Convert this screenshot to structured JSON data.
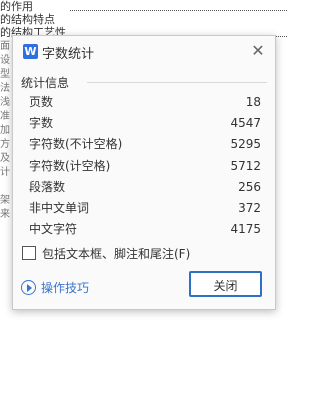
{
  "document": {
    "lines": [
      "的作用",
      "的结构特点",
      "的结构工艺性"
    ],
    "left_fragments": [
      "面",
      "设",
      "型",
      "法",
      "浅",
      "准",
      "加",
      "方",
      "及",
      "计",
      "",
      "架",
      "来"
    ]
  },
  "dialog": {
    "app_icon": "W",
    "title": "字数统计",
    "close_icon": "✕",
    "section_label": "统计信息",
    "stats": [
      {
        "label": "页数",
        "value": "18"
      },
      {
        "label": "字数",
        "value": "4547"
      },
      {
        "label": "字符数(不计空格)",
        "value": "5295"
      },
      {
        "label": "字符数(计空格)",
        "value": "5712"
      },
      {
        "label": "段落数",
        "value": "256"
      },
      {
        "label": "非中文单词",
        "value": "372"
      },
      {
        "label": "中文字符",
        "value": "4175"
      }
    ],
    "checkbox_label": "包括文本框、脚注和尾注(F)",
    "checkbox_checked": false,
    "tips_link": "操作技巧",
    "close_button": "关闭"
  }
}
